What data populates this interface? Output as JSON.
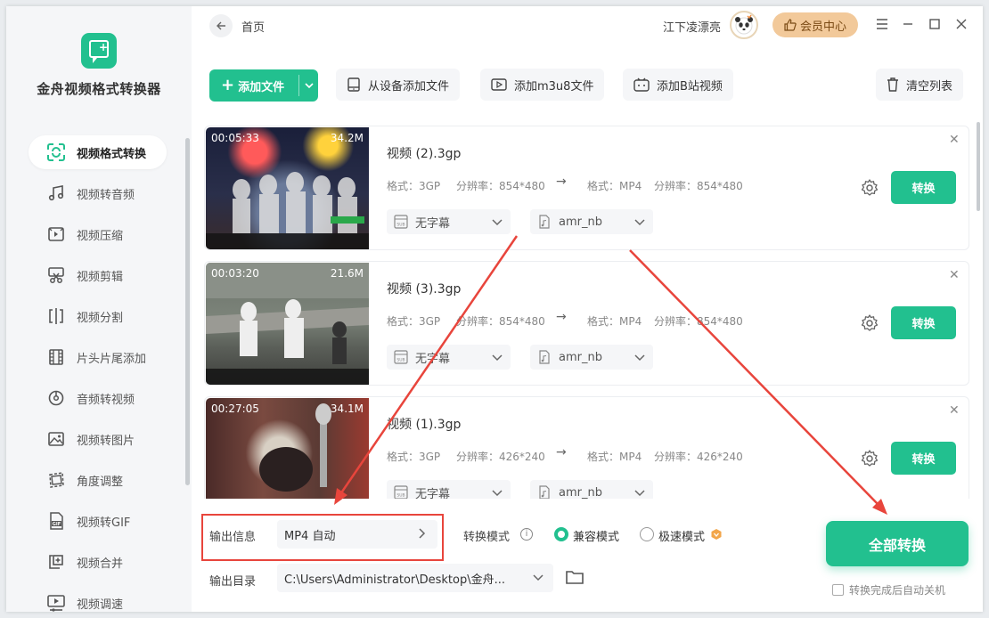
{
  "app": {
    "name": "金舟视频格式转换器"
  },
  "sidebar": {
    "items": [
      {
        "label": "视频格式转换",
        "icon": "convert-icon",
        "active": true
      },
      {
        "label": "视频转音频",
        "icon": "music-note-icon"
      },
      {
        "label": "视频压缩",
        "icon": "compress-icon"
      },
      {
        "label": "视频剪辑",
        "icon": "scissors-icon"
      },
      {
        "label": "视频分割",
        "icon": "split-icon"
      },
      {
        "label": "片头片尾添加",
        "icon": "film-strip-icon"
      },
      {
        "label": "音频转视频",
        "icon": "disc-icon"
      },
      {
        "label": "视频转图片",
        "icon": "image-icon"
      },
      {
        "label": "角度调整",
        "icon": "rotate-icon"
      },
      {
        "label": "视频转GIF",
        "icon": "gif-icon"
      },
      {
        "label": "视频合并",
        "icon": "merge-icon"
      },
      {
        "label": "视频调速",
        "icon": "speed-icon"
      }
    ]
  },
  "header": {
    "breadcrumb": "首页",
    "username": "江下凌漂亮",
    "vip_label": "会员中心"
  },
  "toolbar": {
    "add_file": "添加文件",
    "add_from_device": "从设备添加文件",
    "add_m3u8": "添加m3u8文件",
    "add_bilibili": "添加B站视频",
    "clear_list": "清空列表"
  },
  "files": [
    {
      "name": "视频 (2).3gp",
      "duration": "00:05:33",
      "size": "34.2M",
      "src_format": "格式：3GP",
      "src_resolution": "分辨率：854*480",
      "dst_format": "格式：MP4",
      "dst_resolution": "分辨率：854*480",
      "subtitle": "无字幕",
      "audio": "amr_nb",
      "convert": "转换"
    },
    {
      "name": "视频 (3).3gp",
      "duration": "00:03:20",
      "size": "21.6M",
      "src_format": "格式：3GP",
      "src_resolution": "分辨率：854*480",
      "dst_format": "格式：MP4",
      "dst_resolution": "分辨率：854*480",
      "subtitle": "无字幕",
      "audio": "amr_nb",
      "convert": "转换"
    },
    {
      "name": "视频 (1).3gp",
      "duration": "00:27:05",
      "size": "34.1M",
      "src_format": "格式：3GP",
      "src_resolution": "分辨率：426*240",
      "dst_format": "格式：MP4",
      "dst_resolution": "分辨率：426*240",
      "subtitle": "无字幕",
      "audio": "amr_nb",
      "convert": "转换"
    }
  ],
  "bottom": {
    "output_info_label": "输出信息",
    "output_format": "MP4 自动",
    "mode_label": "转换模式",
    "mode_compatible": "兼容模式",
    "mode_fast": "极速模式",
    "output_dir_label": "输出目录",
    "output_dir": "C:\\Users\\Administrator\\Desktop\\金舟...",
    "convert_all": "全部转换",
    "auto_shutdown": "转换完成后自动关机"
  },
  "colors": {
    "accent": "#22c08f",
    "annotation": "#e8453c",
    "vip": "#f2c99a"
  }
}
